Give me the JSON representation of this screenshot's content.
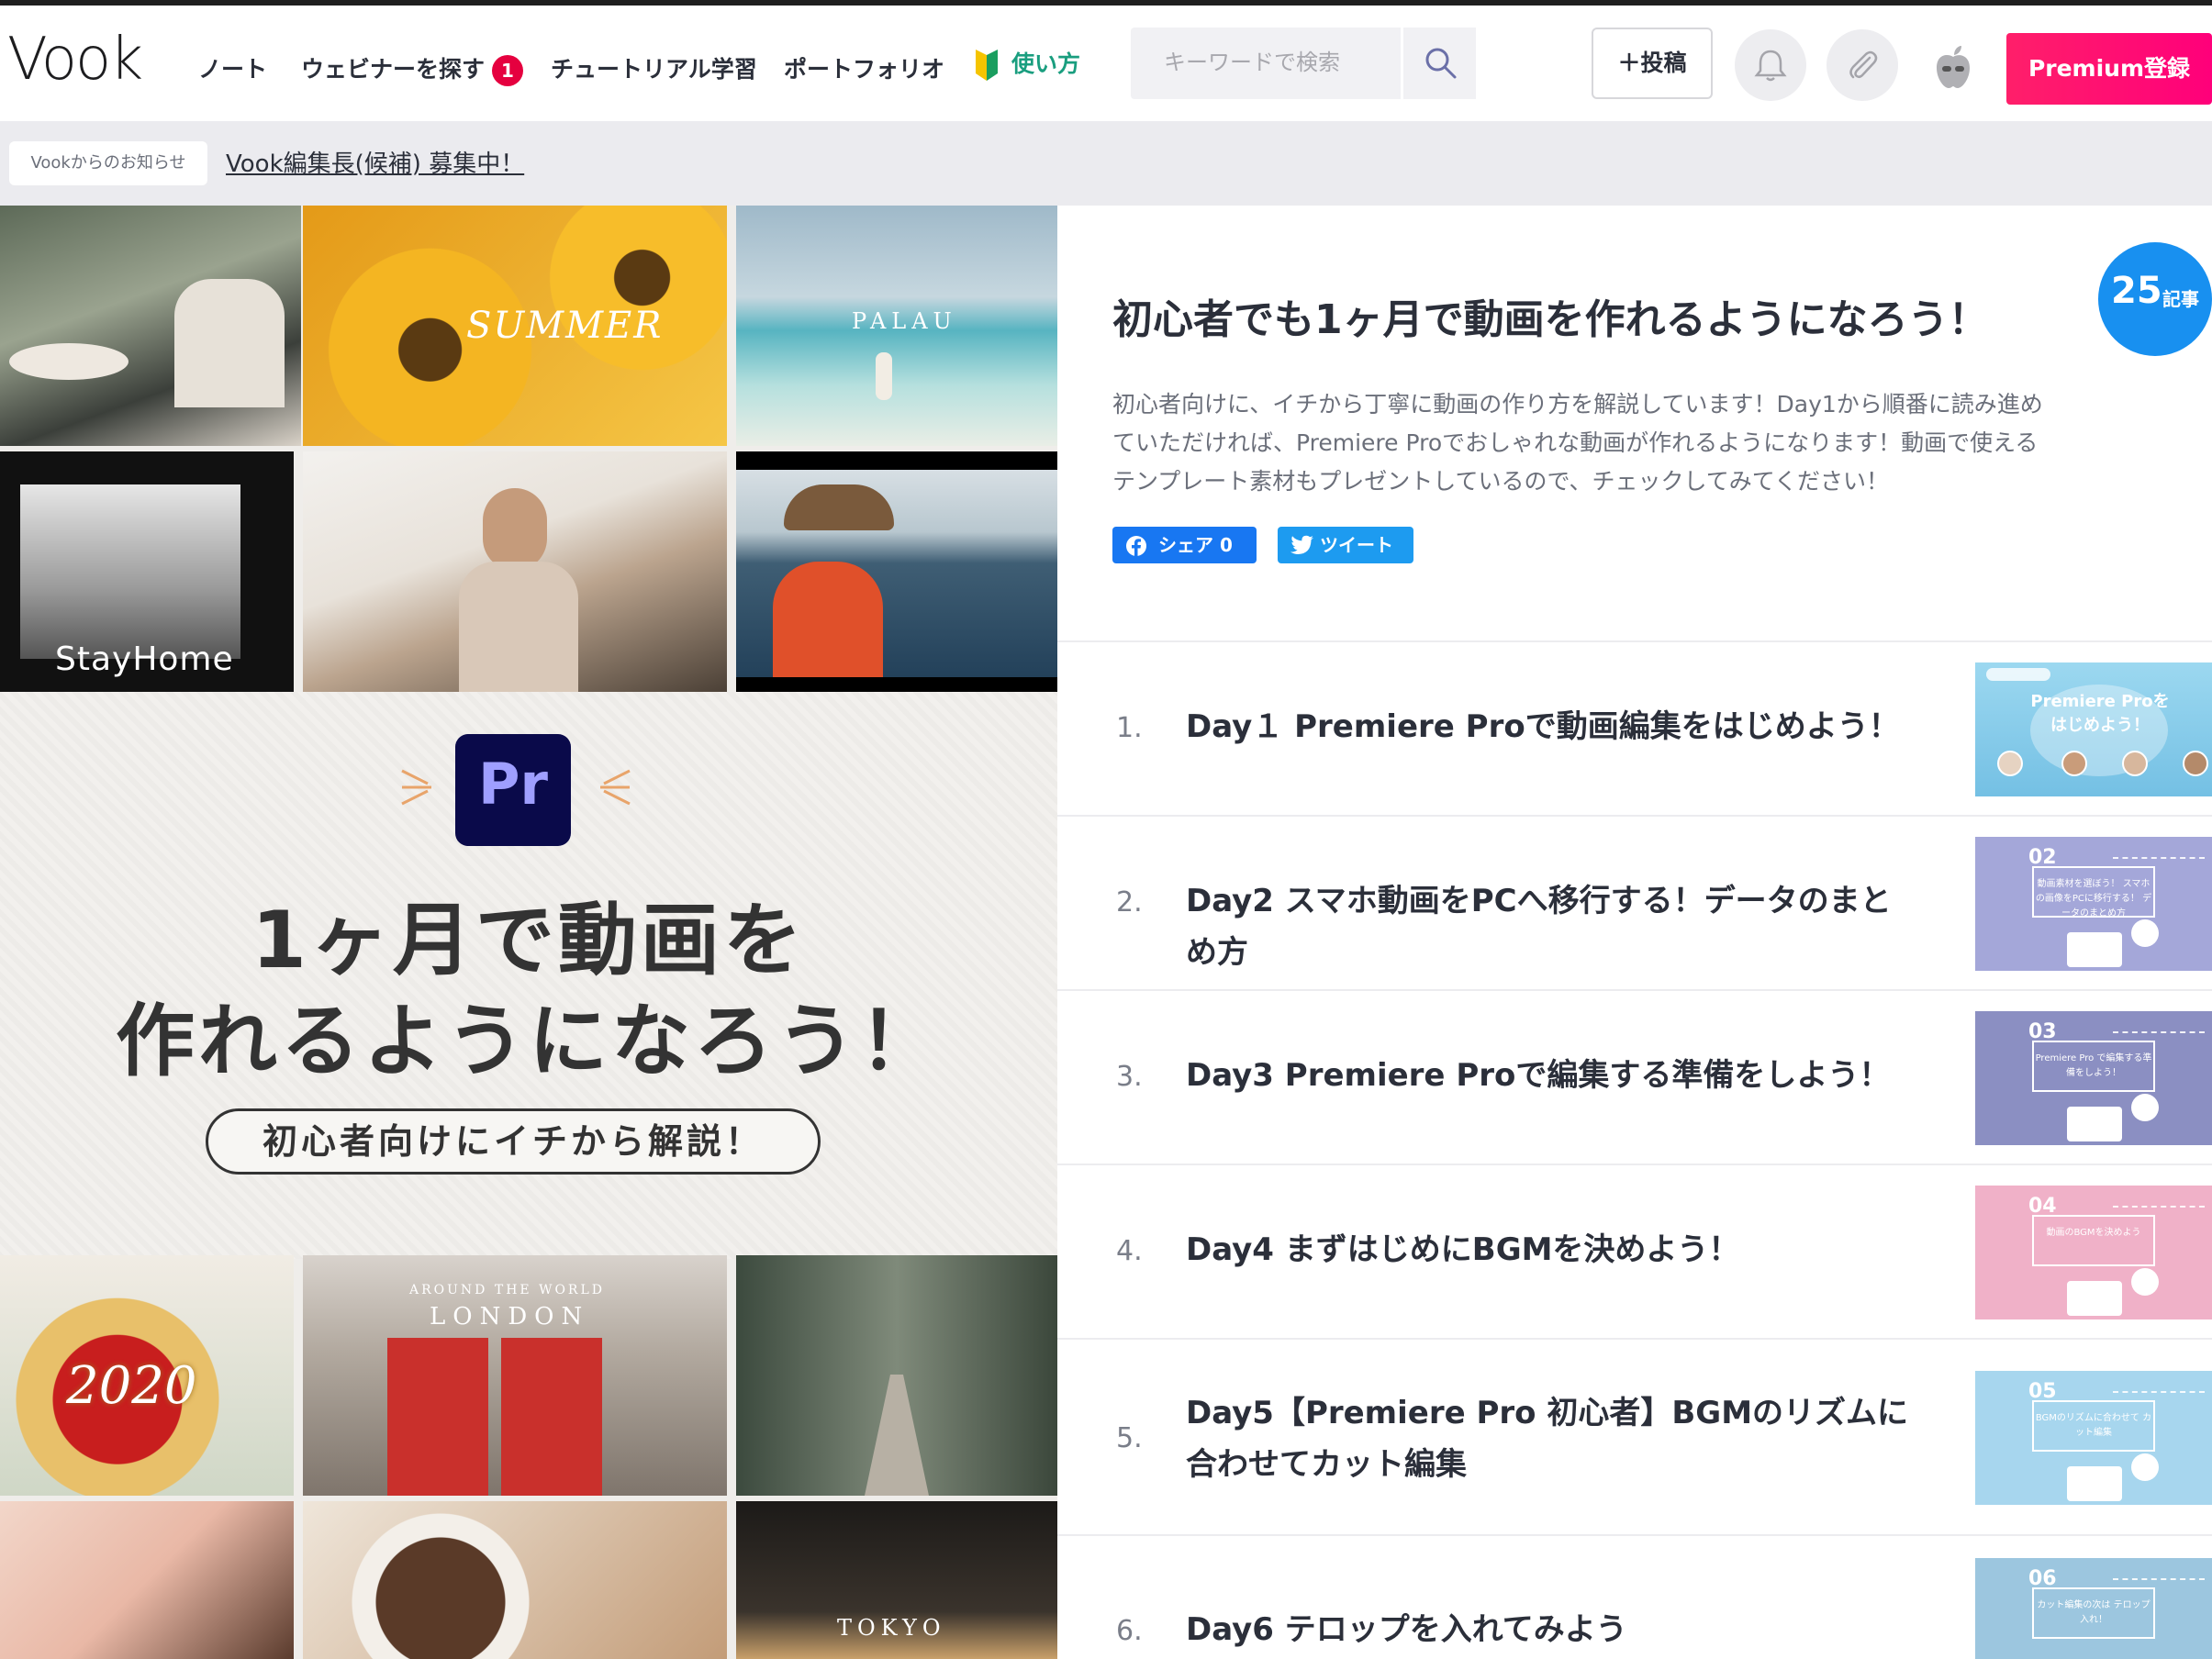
{
  "header": {
    "logo": "Vook",
    "nav": [
      {
        "label": "ノート"
      },
      {
        "label": "ウェビナーを探す",
        "badge": "1"
      },
      {
        "label": "チュートリアル学習"
      },
      {
        "label": "ポートフォリオ"
      },
      {
        "label": "使い方"
      }
    ],
    "search_placeholder": "キーワードで検索",
    "post_label": "＋投稿",
    "premium_label": "Premium登録"
  },
  "notice": {
    "tag": "Vookからのお知らせ",
    "link": "Vook編集長(候補) 募集中！"
  },
  "hero": {
    "icon_label": "Pr",
    "title_line1": "1ヶ月で動画を",
    "title_line2": "作れるようになろう！",
    "subtitle": "初心者向けにイチから解説！",
    "photo_labels": {
      "summer": "SUMMER",
      "palau": "PALAU",
      "stayhome": "StayHome",
      "year": "2020",
      "london_top": "AROUND THE WORLD",
      "london": "LONDON",
      "tokyo": "TOKYO"
    }
  },
  "series": {
    "count": "25",
    "count_unit": "記事",
    "title": "初心者でも1ヶ月で動画を作れるようになろう！",
    "description": "初心者向けに、イチから丁寧に動画の作り方を解説しています！Day1から順番に読み進めていただければ、Premiere Proでおしゃれな動画が作れるようになります！動画で使えるテンプレート素材もプレゼントしているので、チェックしてみてください！",
    "share_fb": "シェア 0",
    "share_tw": "ツイート"
  },
  "articles": [
    {
      "num": "1.",
      "title": "Day１ Premiere Proで動画編集をはじめよう！",
      "thumb_num": "",
      "thumb_text": "Premiere Proを はじめよう！",
      "thumb_color": "#8fd0ec"
    },
    {
      "num": "2.",
      "title": "Day2 スマホ動画をPCへ移行する！データのまとめ方",
      "thumb_num": "02",
      "thumb_text": "動画素材を選ぼう！ スマホの画像をPCに移行する！ データのまとめ方",
      "thumb_color": "#a4a7d9"
    },
    {
      "num": "3.",
      "title": "Day3 Premiere Proで編集する準備をしよう！",
      "thumb_num": "03",
      "thumb_text": "Premiere Pro で編集する準備をしよう！",
      "thumb_color": "#8b8fc2"
    },
    {
      "num": "4.",
      "title": "Day4 まずはじめにBGMを決めよう！",
      "thumb_num": "04",
      "thumb_text": "動画のBGMを決めよう",
      "thumb_color": "#f0b1c8"
    },
    {
      "num": "5.",
      "title": "Day5【Premiere Pro 初心者】BGMのリズムに合わせてカット編集",
      "thumb_num": "05",
      "thumb_text": "BGMのリズムに合わせて カット編集",
      "thumb_color": "#a7d6ee"
    },
    {
      "num": "6.",
      "title": "Day6 テロップを入れてみよう",
      "thumb_num": "06",
      "thumb_text": "カット編集の次は テロップ入れ！",
      "thumb_color": "#9cc6df"
    }
  ]
}
